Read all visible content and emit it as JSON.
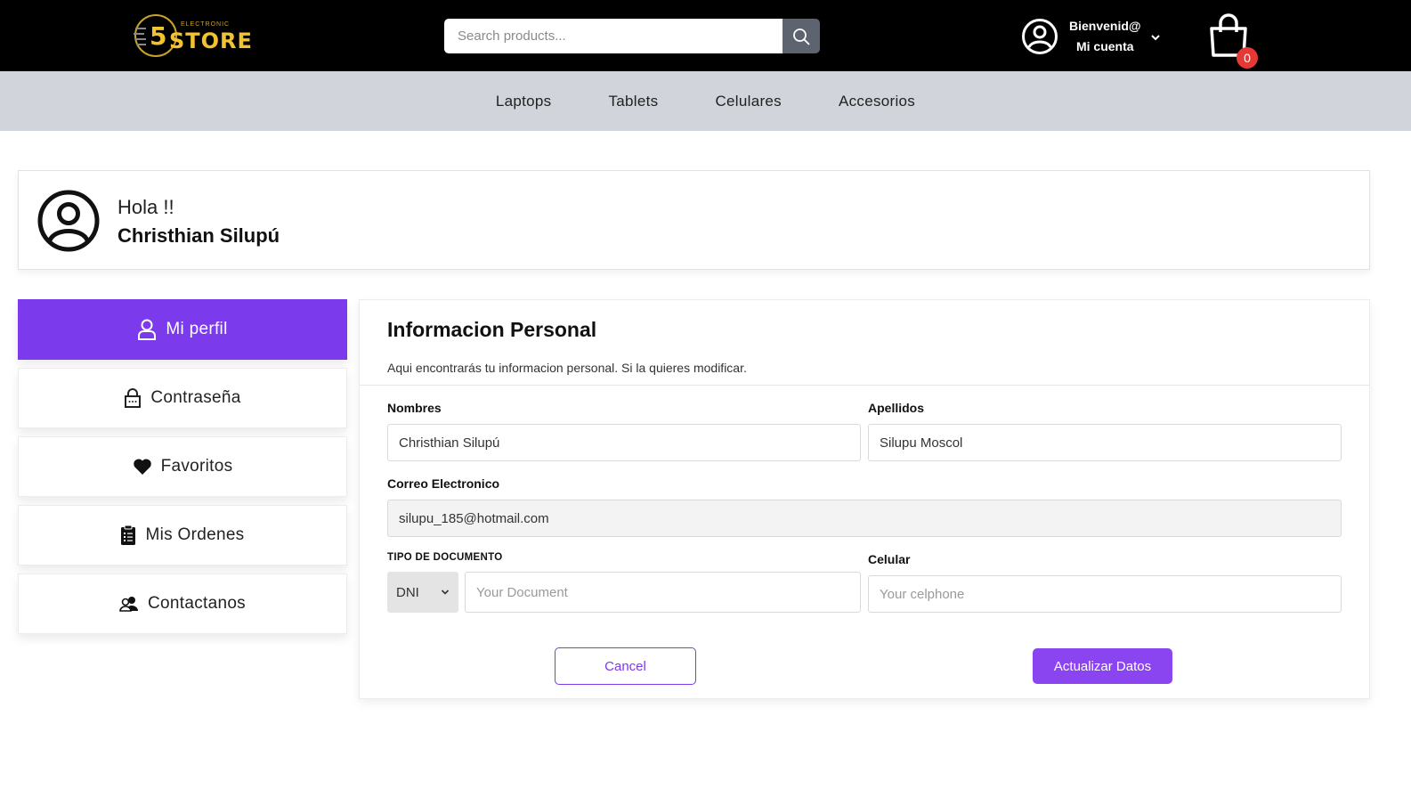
{
  "brand": {
    "logo_text": "STORE",
    "logo_sub": "ELECTRONIC",
    "logo_number": "5",
    "accent_color": "#f2c230"
  },
  "header": {
    "search_placeholder": "Search products...",
    "account_line1": "Bienvenid@",
    "account_line2": "Mi cuenta",
    "cart_count": "0"
  },
  "categories": [
    "Laptops",
    "Tablets",
    "Celulares",
    "Accesorios"
  ],
  "greeting": {
    "hello": "Hola !!",
    "user_name": "Christhian Silupú"
  },
  "sidebar": {
    "items": [
      {
        "label": "Mi perfil",
        "icon": "user-icon",
        "active": true
      },
      {
        "label": "Contraseña",
        "icon": "lock-icon",
        "active": false
      },
      {
        "label": "Favoritos",
        "icon": "heart-icon",
        "active": false
      },
      {
        "label": "Mis Ordenes",
        "icon": "clipboard-list-icon",
        "active": false
      },
      {
        "label": "Contactanos",
        "icon": "users-icon",
        "active": false
      }
    ],
    "active_color": "#7c3aed"
  },
  "profile_form": {
    "title": "Informacion Personal",
    "description": "Aqui encontrarás tu informacion personal. Si la quieres modificar.",
    "first_name_label": "Nombres",
    "first_name_value": "Christhian Silupú",
    "last_name_label": "Apellidos",
    "last_name_value": "Silupu Moscol",
    "email_label": "Correo Electronico",
    "email_value": "silupu_185@hotmail.com",
    "doc_type_label": "TIPO DE DOCUMENTO",
    "doc_type_selected": "DNI",
    "doc_placeholder": "Your Document",
    "phone_label": "Celular",
    "phone_placeholder": "Your celphone",
    "cancel_label": "Cancel",
    "update_label": "Actualizar Datos"
  }
}
